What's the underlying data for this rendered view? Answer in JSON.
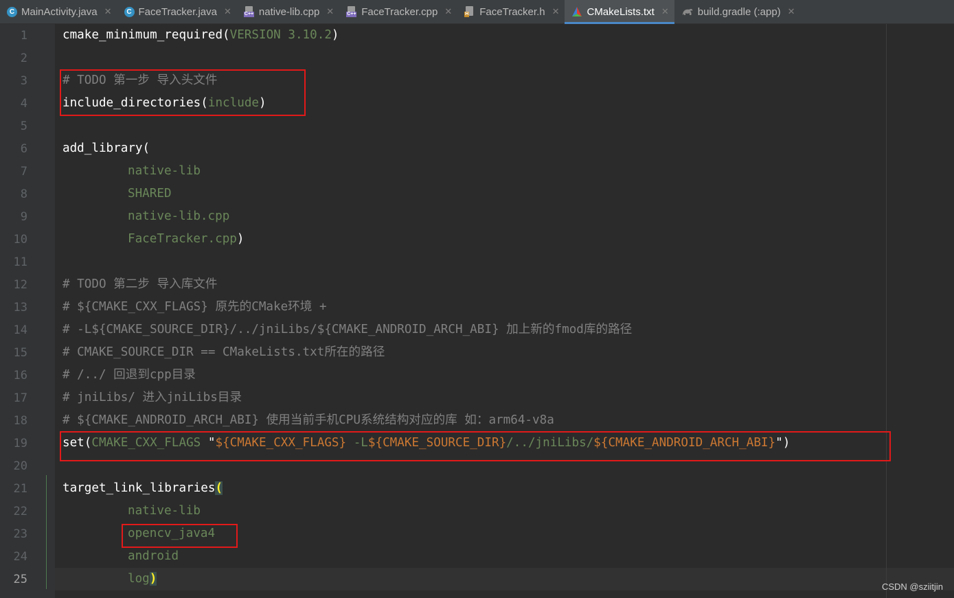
{
  "tabs": [
    {
      "label": "MainActivity.java",
      "icon": "java-class-icon",
      "active": false
    },
    {
      "label": "FaceTracker.java",
      "icon": "java-class-icon",
      "active": false
    },
    {
      "label": "native-lib.cpp",
      "icon": "cpp-file-icon",
      "active": false
    },
    {
      "label": "FaceTracker.cpp",
      "icon": "cpp-file-icon",
      "active": false
    },
    {
      "label": "FaceTracker.h",
      "icon": "header-file-icon",
      "active": false
    },
    {
      "label": "CMakeLists.txt",
      "icon": "cmake-icon",
      "active": true
    },
    {
      "label": "build.gradle (:app)",
      "icon": "gradle-icon",
      "active": false
    }
  ],
  "line_numbers": [
    "1",
    "2",
    "3",
    "4",
    "5",
    "6",
    "7",
    "8",
    "9",
    "10",
    "11",
    "12",
    "13",
    "14",
    "15",
    "16",
    "17",
    "18",
    "19",
    "20",
    "21",
    "22",
    "23",
    "24",
    "25"
  ],
  "code": {
    "l1": {
      "fn": "cmake_minimum_required(",
      "arg": "VERSION 3.10.2",
      "end": ")"
    },
    "l3": "# TODO 第一步 导入头文件",
    "l4": {
      "fn": "include_directories(",
      "arg": "include",
      "end": ")"
    },
    "l6": "add_library(",
    "l7": "native-lib",
    "l8": "SHARED",
    "l9": "native-lib.cpp",
    "l10": {
      "arg": "FaceTracker.cpp",
      "end": ")"
    },
    "l12": "# TODO 第二步 导入库文件",
    "l13": "# ${CMAKE_CXX_FLAGS} 原先的CMake环境 +",
    "l14": "# -L${CMAKE_SOURCE_DIR}/../jniLibs/${CMAKE_ANDROID_ARCH_ABI} 加上新的fmod库的路径",
    "l15": "# CMAKE_SOURCE_DIR == CMakeLists.txt所在的路径",
    "l16": "# /../ 回退到cpp目录",
    "l17": "# jniLibs/ 进入jniLibs目录",
    "l18": "# ${CMAKE_ANDROID_ARCH_ABI} 使用当前手机CPU系统结构对应的库 如：arm64-v8a",
    "l19": {
      "fn": "set(",
      "arg": "CMAKE_CXX_FLAGS ",
      "q1": "\"",
      "v1": "${CMAKE_CXX_FLAGS}",
      "s1": " -L",
      "v2": "${CMAKE_SOURCE_DIR}",
      "s2": "/../jniLibs/",
      "v3": "${CMAKE_ANDROID_ARCH_ABI}",
      "q2": "\"",
      "end": ")"
    },
    "l21": {
      "fn": "target_link_libraries",
      "paren": "("
    },
    "l22": "native-lib",
    "l23": "opencv_java4",
    "l24": "android",
    "l25": {
      "arg": "log",
      "paren": ")"
    }
  },
  "watermark": "CSDN @sziitjin"
}
